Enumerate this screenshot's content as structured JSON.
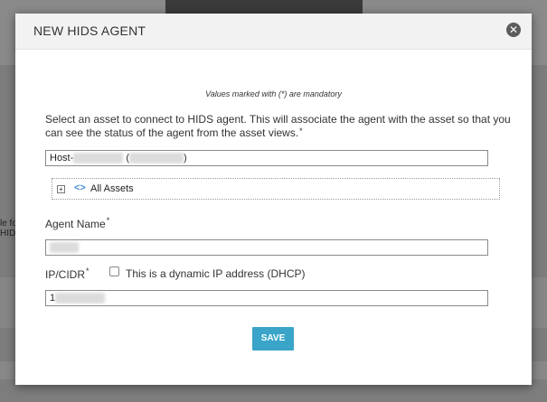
{
  "dialog": {
    "title": "NEW HIDS AGENT",
    "close_icon": "close-icon",
    "mandatory_note": "Values marked with (*) are mandatory",
    "intro_text": "Select an asset to connect to HIDS agent. This will associate the agent with the asset so that you can see the status of the agent from the asset views.",
    "asset_field": {
      "prefix": "Host-",
      "middle": " (",
      "suffix": ")"
    },
    "tree": {
      "label": "All Assets",
      "expander": "+"
    },
    "agent_name": {
      "label": "Agent Name",
      "value": ""
    },
    "ip": {
      "label": "IP/CIDR",
      "value_prefix": "1",
      "dhcp_label": "This is a dynamic IP address (DHCP)"
    },
    "required_marker": "*",
    "save_label": "SAVE"
  },
  "background": {
    "left_fragment_1": "le fo",
    "left_fragment_2": "HID"
  },
  "colors": {
    "save_button": "#3aa5c8",
    "header_bg": "#f2f2f2",
    "overlay": "#7d7d7d"
  }
}
